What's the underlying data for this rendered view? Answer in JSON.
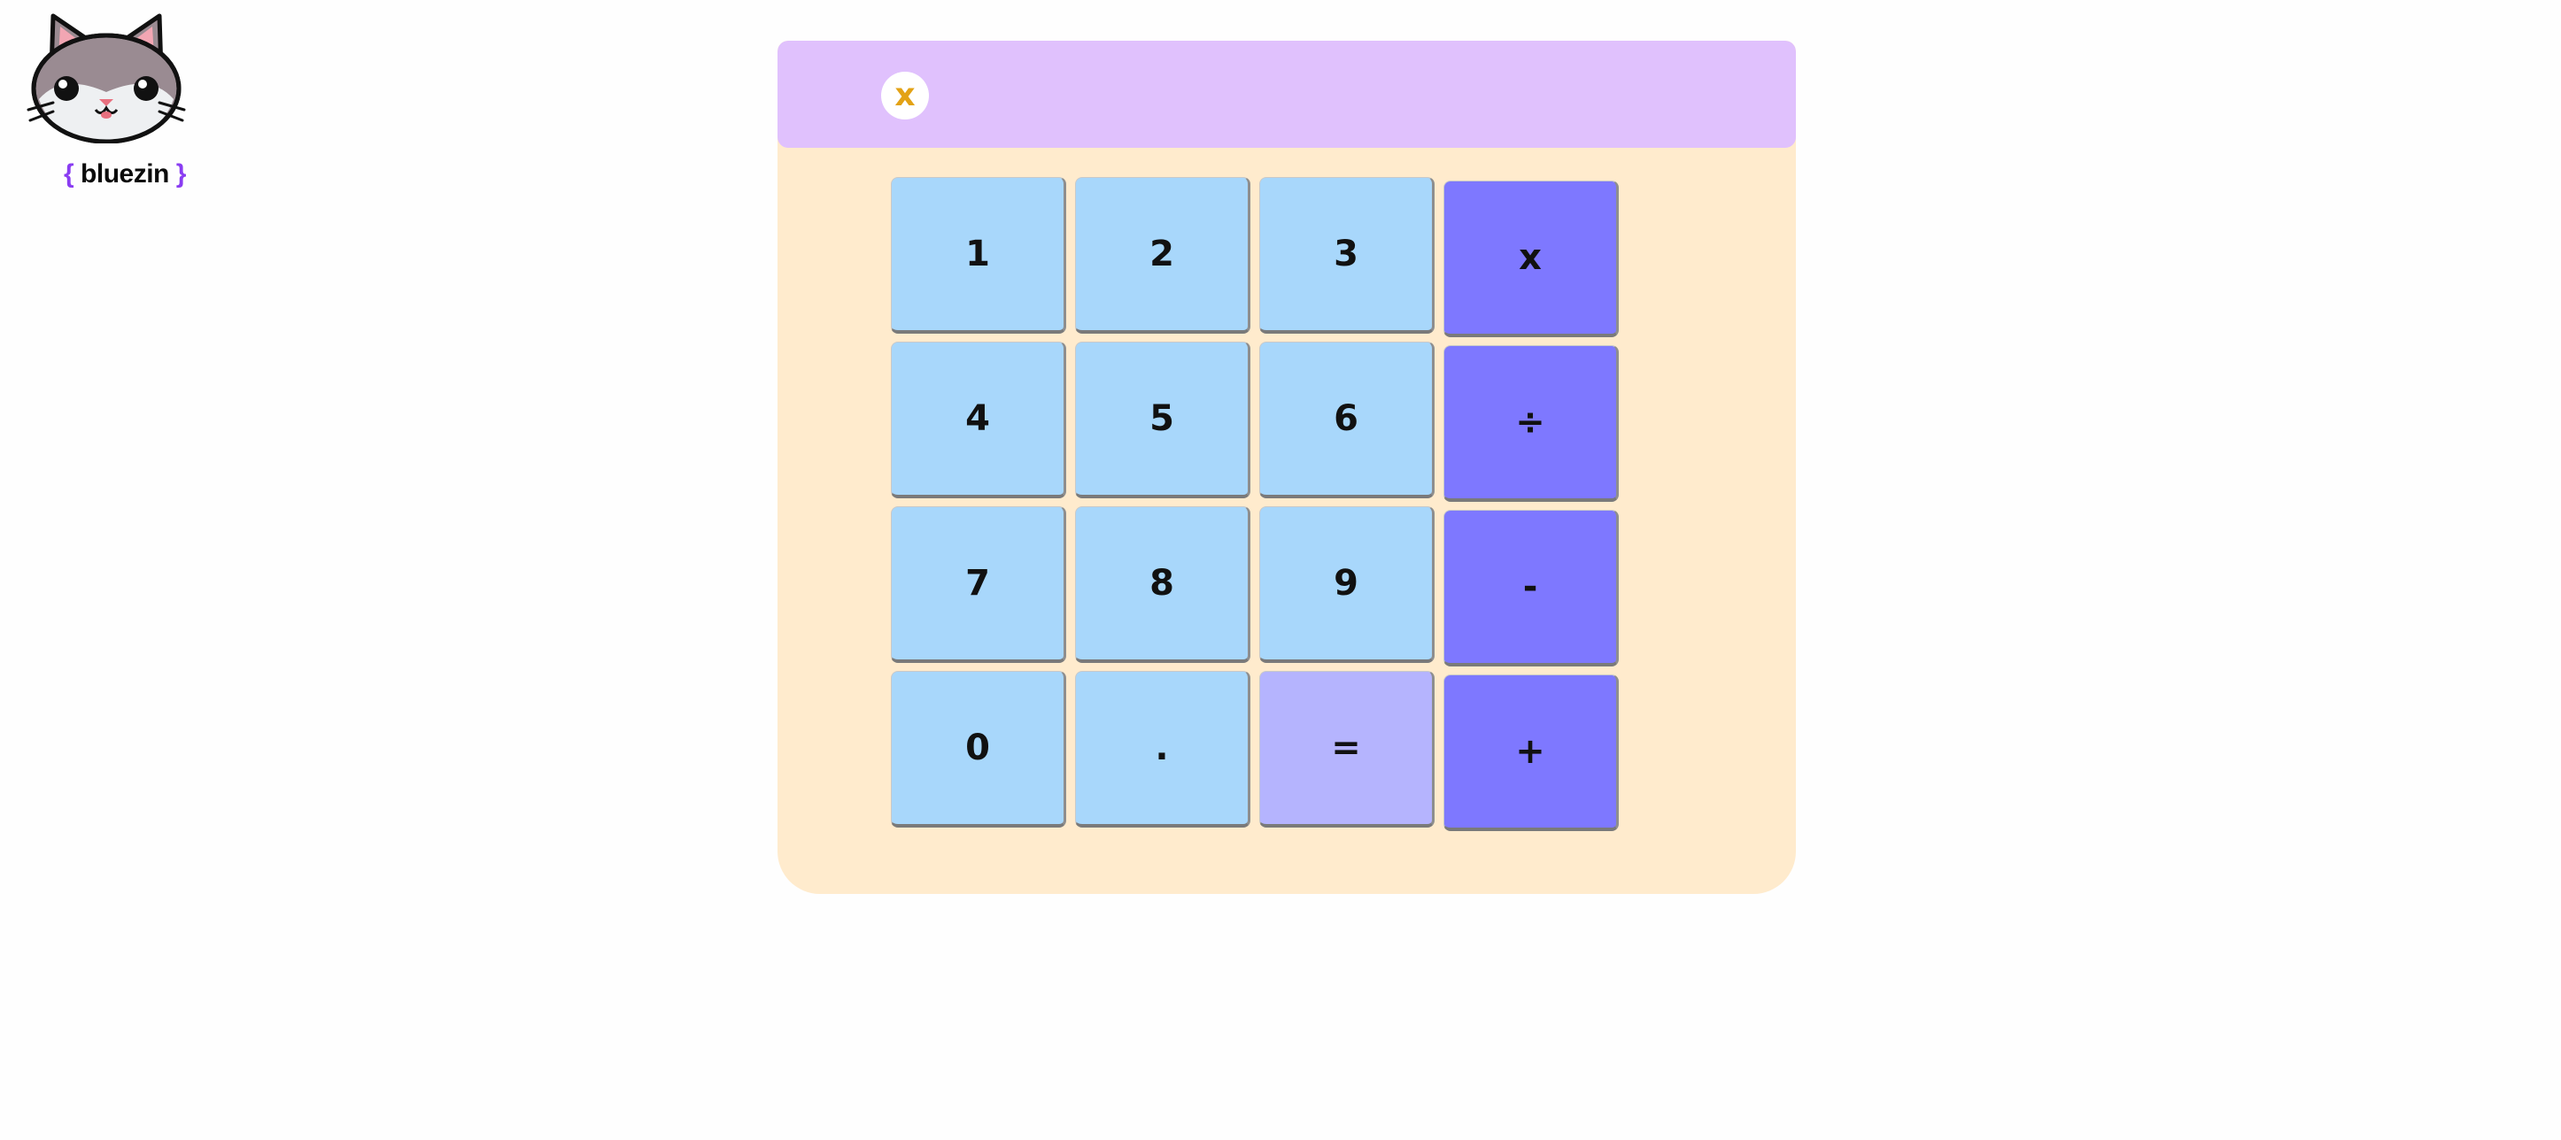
{
  "brand": {
    "open_brace": "{",
    "name": "bluezin",
    "close_brace": "}",
    "logo_icon": "cat-face-icon"
  },
  "display": {
    "value": "x"
  },
  "keys": {
    "k1": "1",
    "k2": "2",
    "k3": "3",
    "multiply": "x",
    "k4": "4",
    "k5": "5",
    "k6": "6",
    "divide": "÷",
    "k7": "7",
    "k8": "8",
    "k9": "9",
    "minus": "-",
    "k0": "0",
    "dot": ".",
    "equals": "=",
    "plus": "+"
  },
  "colors": {
    "panel_bg": "#ffebcd",
    "display_bg": "#e0c1fd",
    "digit_key": "#a8d7fb",
    "equals_key": "#b5b4fe",
    "operator_key": "#7e78ff",
    "display_text": "#e3a215",
    "brand_brace": "#8a3df2"
  }
}
